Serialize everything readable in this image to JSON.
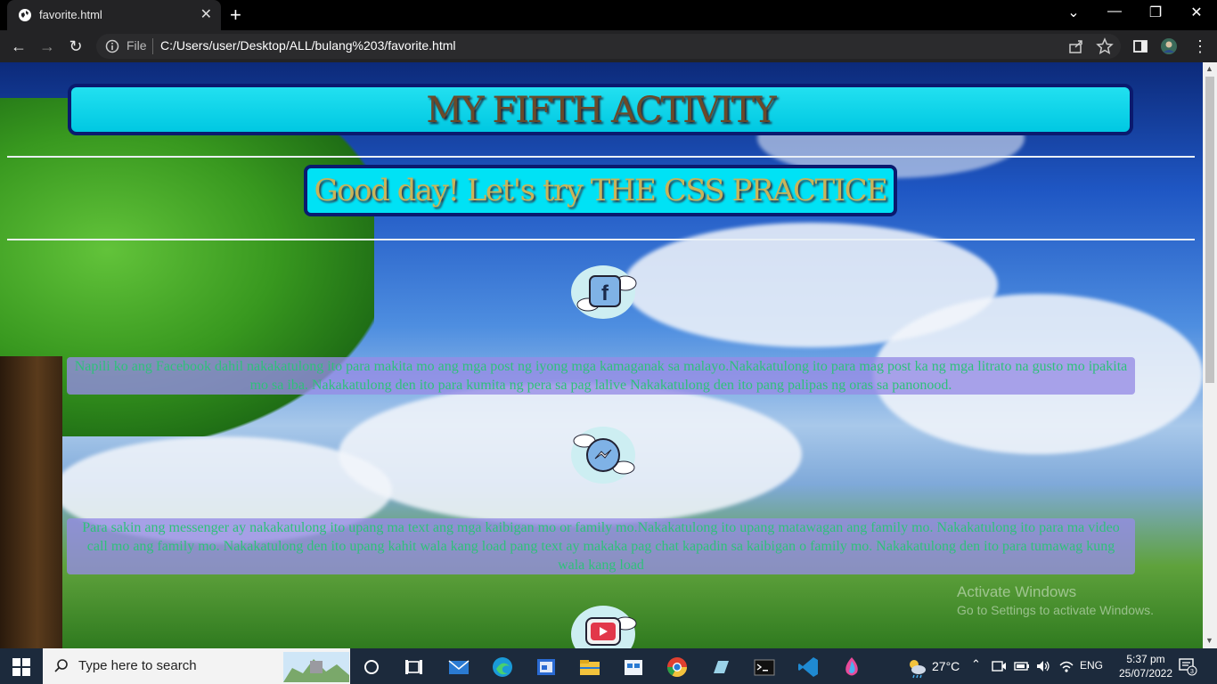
{
  "browser": {
    "tab_title": "favorite.html",
    "tab_close": "✕",
    "new_tab": "+",
    "omnibox_file": "File",
    "url": "C:/Users/user/Desktop/ALL/bulang%203/favorite.html",
    "nav": {
      "back": "←",
      "forward": "→",
      "reload": "↻"
    },
    "window_controls": {
      "chevron": "⌄",
      "minimize": "—",
      "restore": "❐",
      "close": "✕"
    }
  },
  "page": {
    "title": "MY FIFTH ACTIVITY",
    "subtitle": "Good day! Let's try THE CSS PRACTICE",
    "sections": [
      {
        "icon": "facebook-icon",
        "text": "Napili ko ang Facebook dahil nakakatulong ito para makita mo ang mga post ng iyong mga kamaganak sa malayo.Nakakatulong ito para mag post ka ng mga litrato na gusto mo ipakita mo sa iba. Nakakatulong den ito para kumita ng pera sa pag lalive Nakakatulong den ito pang palipas ng oras sa panonood."
      },
      {
        "icon": "messenger-icon",
        "text": "Para sakin ang messenger ay nakakatulong ito upang ma text ang mga kaibigan mo or family mo.Nakakatulong ito upang matawagan ang family mo. Nakakatulong ito para ma video call mo ang family mo. Nakakatulong den ito upang kahit wala kang load pang text ay makaka pag chat kapadin sa kaibigan o family mo. Nakakatulong den ito para tumawag kung wala kang load"
      },
      {
        "icon": "youtube-icon"
      }
    ],
    "activation_title": "Activate Windows",
    "activation_sub": "Go to Settings to activate Windows."
  },
  "taskbar": {
    "search_placeholder": "Type here to search",
    "temperature": "27°C",
    "language": "ENG",
    "time": "5:37 pm",
    "date": "25/07/2022",
    "notifications": "3"
  },
  "colors": {
    "title_bg": "#00c8e2",
    "title_border": "#0a1a6e",
    "title_text": "#6a4a2a",
    "subtitle_text": "#c8b45a",
    "para_bg": "#968ce6",
    "para_text": "#2fc07a"
  }
}
